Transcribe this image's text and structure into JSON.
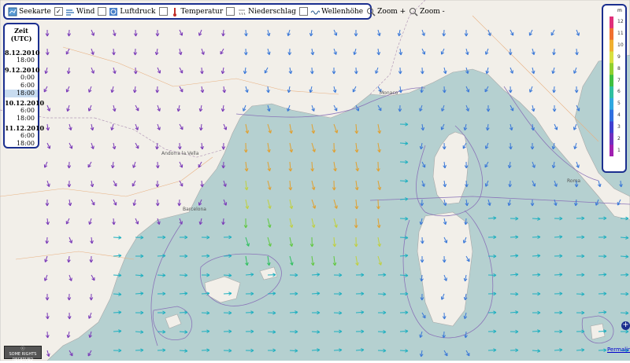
{
  "toolbar": {
    "items": [
      {
        "label": "Seekarte",
        "icon": "map-icon",
        "checked": true
      },
      {
        "label": "Wind",
        "icon": "wind-icon",
        "checked": true
      },
      {
        "label": "Luftdruck",
        "icon": "pressure-icon",
        "checked": false
      },
      {
        "label": "Temperatur",
        "icon": "thermometer-icon",
        "checked": false
      },
      {
        "label": "Niederschlag",
        "icon": "rain-icon",
        "checked": false
      },
      {
        "label": "Wellenhöhe",
        "icon": "wave-icon",
        "checked": false
      }
    ],
    "zoom_in_label": "Zoom +",
    "zoom_out_label": "Zoom -"
  },
  "time_panel": {
    "title": "Zeit (UTC)",
    "days": [
      {
        "date": "8.12.2010",
        "times": [
          "18:00"
        ]
      },
      {
        "date": "9.12.2010",
        "times": [
          "0:00",
          "6:00",
          "18:00"
        ]
      },
      {
        "date": "10.12.2010",
        "times": [
          "6:00",
          "18:00"
        ]
      },
      {
        "date": "11.12.2010",
        "times": [
          "6:00",
          "18:00"
        ]
      }
    ],
    "selected": "9.12.2010 18:00"
  },
  "legend": {
    "unit": "m",
    "ticks": [
      "12",
      "11",
      "10",
      "9",
      "8",
      "7",
      "6",
      "5",
      "4",
      "3",
      "2",
      "1"
    ],
    "colors": [
      "#e0307a",
      "#f07030",
      "#f0b030",
      "#d8e040",
      "#90d030",
      "#40c040",
      "#30c0a0",
      "#30a8e0",
      "#3070e0",
      "#4040d0",
      "#7030c0",
      "#a020b0"
    ]
  },
  "map": {
    "land_color": "#f2efe9",
    "sea_color": "#b5d0d0",
    "places": [
      "Andorra la Vella",
      "Monaco",
      "Roma",
      "Barcelona"
    ]
  },
  "footer": {
    "license_label": "SOME RIGHTS RESERVED",
    "permalink_label": "Permalink",
    "plus_label": "+"
  }
}
